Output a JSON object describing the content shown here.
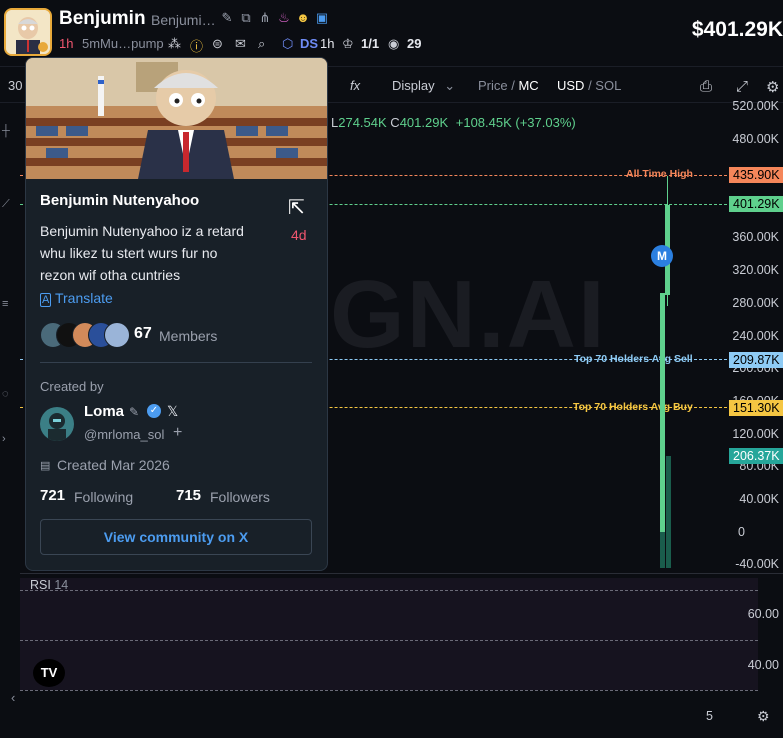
{
  "header": {
    "token_name": "Benjumin",
    "token_full": "Benjumi…",
    "age": "1h",
    "pump": "5mMu…pump",
    "ds_label": "DS",
    "ds_age": "1h",
    "ratio": "1/1",
    "holders": "29",
    "price": "$401.29K"
  },
  "toolbar": {
    "interval": "30",
    "fx": "fx",
    "display": "Display",
    "price": "Price",
    "mc": "MC",
    "usd": "USD",
    "sol": "SOL"
  },
  "ohlc": {
    "low_label": "L",
    "low": "274.54K",
    "close_label": "C",
    "close": "401.29K",
    "change": "+108.45K (+37.03%)"
  },
  "chart": {
    "watermark": "GN.AI",
    "y_ticks": [
      "520.00K",
      "480.00K",
      "440.00K",
      "400.00K",
      "360.00K",
      "320.00K",
      "280.00K",
      "240.00K",
      "200.00K",
      "160.00K",
      "120.00K",
      "80.00K",
      "40.00K",
      "0",
      "-40.00K"
    ],
    "ath_label": "All Time High",
    "ath_tag": "435.90K",
    "price_tag": "401.29K",
    "avg_sell_label": "Top 70 Holders Avg Sell",
    "avg_sell_tag": "209.87K",
    "avg_buy_label": "Top 70 Holders Avg Buy",
    "avg_buy_tag": "151.30K",
    "vol_tag": "206.37K",
    "marker": "M",
    "colors": {
      "up": "#5fd08d",
      "ath": "#f5865a",
      "sell": "#8ecbf5",
      "buy": "#f5c642",
      "vol": "#26a69a"
    }
  },
  "rsi": {
    "label": "RSI",
    "period": "14",
    "ticks": [
      "60.00",
      "40.00"
    ],
    "x_tick": "5"
  },
  "card": {
    "title": "Benjumin Nutenyahoo",
    "desc_1": "Benjumin Nutenyahoo iz a retard",
    "desc_2": "whu likez tu stert wurs fur no",
    "desc_3": "rezon wif otha cuntries",
    "age": "4d",
    "translate": "Translate",
    "members_count": "67",
    "members_label": "Members",
    "created_by": "Created by",
    "creator_name": "Loma",
    "creator_handle": "@mrloma_sol",
    "created_date": "Created Mar 2026",
    "following_count": "721",
    "following_label": "Following",
    "followers_count": "715",
    "followers_label": "Followers",
    "view_button": "View community on X"
  }
}
